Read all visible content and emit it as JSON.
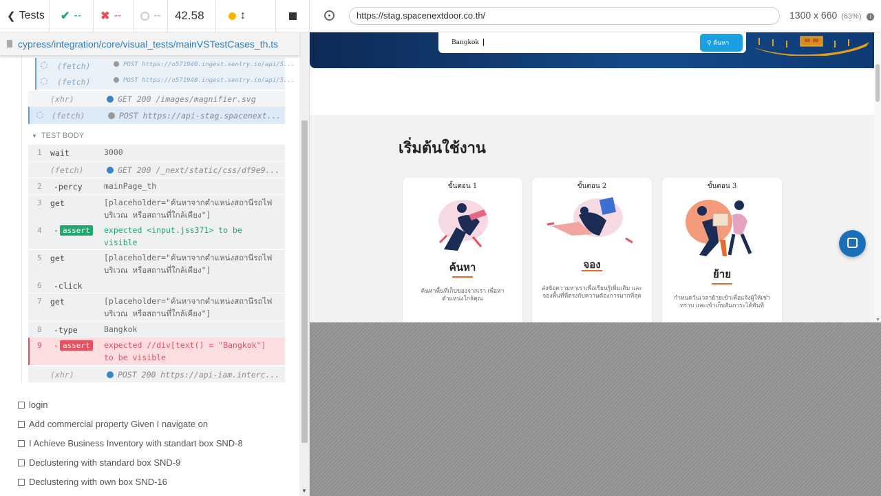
{
  "stats": {
    "tests_label": "Tests",
    "passed": "--",
    "failed": "--",
    "pending": "--",
    "duration": "42.58"
  },
  "spec": {
    "path": "cypress/integration/core/visual_tests/mainVSTestCases_th.ts"
  },
  "commands": {
    "fetch1": {
      "name": "(fetch)",
      "msg": "POST https://o571940.ingest.sentry.io/api/5..."
    },
    "fetch2": {
      "name": "(fetch)",
      "msg": "POST https://o571940.ingest.sentry.io/api/5..."
    },
    "xhr1": {
      "name": "(xhr)",
      "msg": "GET 200 /images/magnifier.svg"
    },
    "fetch3": {
      "name": "(fetch)",
      "msg": "POST https://api-stag.spacenext..."
    },
    "test_body": "TEST BODY",
    "c1": {
      "num": "1",
      "name": "wait",
      "msg": "3000"
    },
    "fetch4": {
      "name": "(fetch)",
      "msg": "GET 200 /_next/static/css/df9e9..."
    },
    "c2": {
      "num": "2",
      "name": "-percy",
      "msg": "mainPage_th"
    },
    "c3": {
      "num": "3",
      "name": "get",
      "msg": "[placeholder=\"ค้นหาจากตำแหน่งสถานีรถไฟ\nบริเวณ หรือสถานที่ใกล้เคียง\"]"
    },
    "c4": {
      "num": "4",
      "name": "-",
      "badge": "assert",
      "msg": "expected <input.jss371> to be\nvisible"
    },
    "c5": {
      "num": "5",
      "name": "get",
      "msg": "[placeholder=\"ค้นหาจากตำแหน่งสถานีรถไฟ\nบริเวณ หรือสถานที่ใกล้เคียง\"]"
    },
    "c6": {
      "num": "6",
      "name": "-click"
    },
    "c7": {
      "num": "7",
      "name": "get",
      "msg": "[placeholder=\"ค้นหาจากตำแหน่งสถานีรถไฟ\nบริเวณ หรือสถานที่ใกล้เคียง\"]"
    },
    "c8": {
      "num": "8",
      "name": "-type",
      "msg": "Bangkok"
    },
    "c9": {
      "num": "9",
      "name": "-",
      "badge": "assert",
      "msg": "expected //div[text() = \"Bangkok\"]\nto be visible"
    },
    "xhr2": {
      "name": "(xhr)",
      "msg": "POST 200 https://api-iam.interc..."
    }
  },
  "tests": [
    "login",
    "Add commercial property Given I navigate on",
    "I Achieve Business Inventory with standart box SND-8",
    "Declustering with standard box SND-9",
    "Declustering with own box SND-16"
  ],
  "browser": {
    "url": "https://stag.spacenextdoor.co.th/",
    "viewport": "1300 x 660",
    "scale": "(63%)"
  },
  "app": {
    "search_value": "Bangkok",
    "search_button": "ค้นหา",
    "section_title": "เริ่มต้นใช้งาน",
    "steps": [
      {
        "label": "ขั้นตอน 1",
        "title": "ค้นหา",
        "desc": "ค้นหาพื้นที่เก็บของจากเรา เพื่อหา\nตำแหน่งใกล้คุณ"
      },
      {
        "label": "ขั้นตอน 2",
        "title": "จอง",
        "desc": "ส่งข้อความหาเราเพื่อเรียนรู้เพิ่มเติม และ\nจองพื้นที่ที่ตรงกับความต้องการมากที่สุด"
      },
      {
        "label": "ขั้นตอน 3",
        "title": "ย้าย",
        "desc": "กำหนดวันเวลาย้ายเข้าเพื่อแจ้งผู้ให้เช่า\nทราบ และเข้าเก็บสัมภาระได้ทันที"
      }
    ]
  },
  "colors": {
    "pass": "#1fa971",
    "fail": "#e94f5f",
    "accent": "#2f7fbf",
    "brand_orange": "#e8692e",
    "header_blue": "#0e2c5a",
    "chat_blue": "#1b6fb8"
  }
}
